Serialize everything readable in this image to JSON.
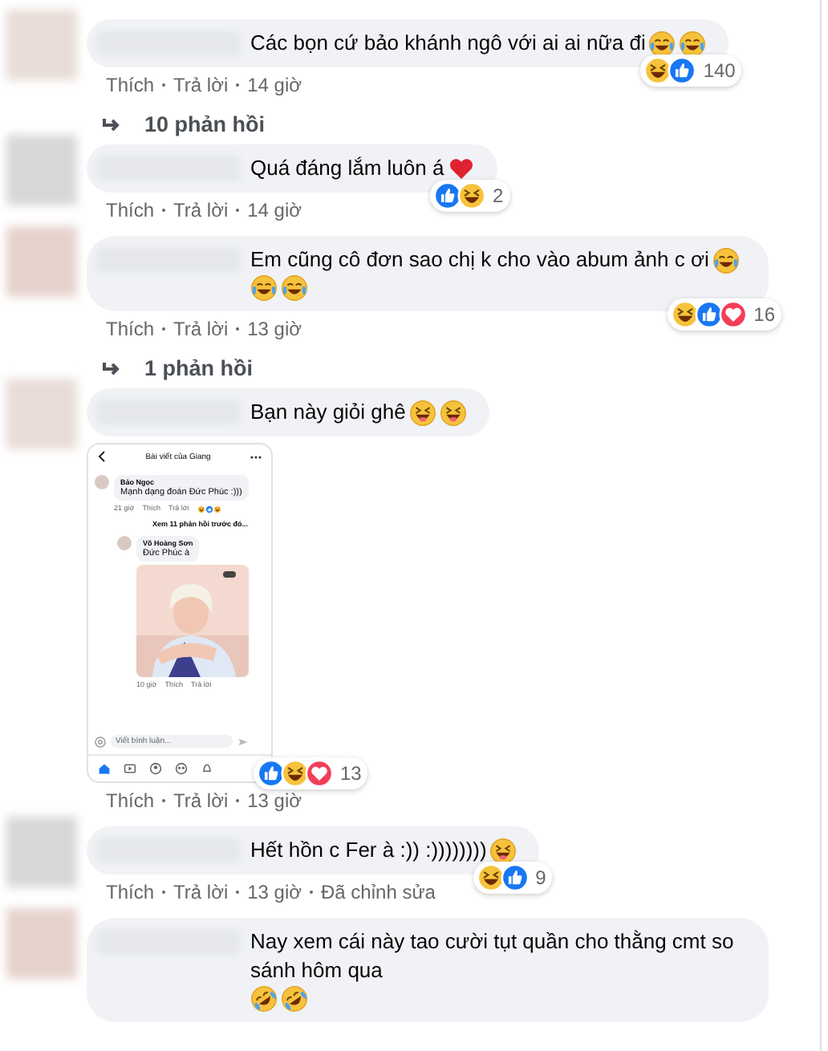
{
  "comments": [
    {
      "text": "Các bọn cứ bảo khánh ngô với ai ai nữa đi",
      "emojis": [
        {
          "kind": "tears"
        },
        {
          "kind": "tears"
        }
      ],
      "reactions": {
        "icons": [
          {
            "kind": "haha"
          },
          {
            "kind": "like"
          }
        ],
        "count": "140"
      },
      "actions": [
        "Thích",
        "Trả lời",
        "14 giờ"
      ],
      "replies": "10 phản hồi"
    },
    {
      "text": "Quá đáng lắm luôn á",
      "emojis": [
        {
          "kind": "heart"
        }
      ],
      "reactions": {
        "icons": [
          {
            "kind": "like"
          },
          {
            "kind": "haha"
          }
        ],
        "count": "2"
      },
      "actions": [
        "Thích",
        "Trả lời",
        "14 giờ"
      ]
    },
    {
      "text": "Em cũng cô đơn sao chị k cho vào abum ảnh c ơi",
      "emojis": [
        {
          "kind": "tears"
        },
        {
          "kind": "tears"
        },
        {
          "kind": "tears"
        }
      ],
      "reactions": {
        "icons": [
          {
            "kind": "haha"
          },
          {
            "kind": "like"
          },
          {
            "kind": "love"
          }
        ],
        "count": "16"
      },
      "actions": [
        "Thích",
        "Trả lời",
        "13 giờ"
      ],
      "replies": "1 phản hồi"
    },
    {
      "text": "Bạn này giỏi ghê",
      "emojis": [
        {
          "kind": "xd"
        },
        {
          "kind": "xd"
        }
      ],
      "attachment": {
        "header": "Bài viết của Giang",
        "comment": {
          "author": "Bảo Ngọc",
          "text": "Mạnh dạng đoán Đức Phúc :)))",
          "time": "21 giờ",
          "actions": [
            "Thích",
            "Trả lời"
          ]
        },
        "more_replies": "Xem 11 phản hồi trước đó...",
        "reply": {
          "author": "Võ Hoàng Sơn",
          "text": "Đức Phúc à",
          "time": "10 giờ",
          "actions": [
            "Thích",
            "Trả lời"
          ]
        },
        "input_placeholder": "Viết bình luận..."
      },
      "reactions": {
        "icons": [
          {
            "kind": "like"
          },
          {
            "kind": "haha"
          },
          {
            "kind": "love"
          }
        ],
        "count": "13"
      },
      "actions": [
        "Thích",
        "Trả lời",
        "13 giờ"
      ]
    },
    {
      "text": "Hết hồn c Fer à :)) :))))))))",
      "emojis": [
        {
          "kind": "xd"
        }
      ],
      "reactions": {
        "icons": [
          {
            "kind": "haha"
          },
          {
            "kind": "like"
          }
        ],
        "count": "9"
      },
      "actions": [
        "Thích",
        "Trả lời",
        "13 giờ",
        "Đã chỉnh sửa"
      ]
    },
    {
      "text": "Nay xem cái này tao cười tụt quần cho thằng cmt so sánh hôm qua",
      "emojis": [
        {
          "kind": "rofl"
        },
        {
          "kind": "rofl"
        }
      ]
    }
  ]
}
